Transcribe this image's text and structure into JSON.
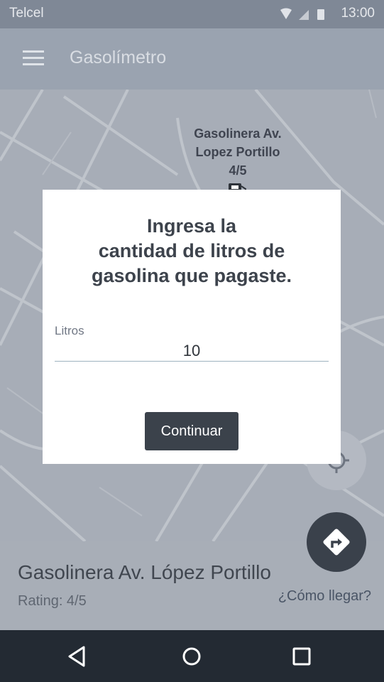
{
  "status_bar": {
    "carrier": "Telcel",
    "time": "13:00",
    "icons": [
      "wifi-icon",
      "signal-icon",
      "battery-icon"
    ]
  },
  "app_bar": {
    "title": "Gasolímetro",
    "menu_icon": "hamburger-menu-icon"
  },
  "map": {
    "marker": {
      "line1": "Gasolinera Av.",
      "line2": "Lopez Portillo",
      "rating": "4/5"
    }
  },
  "dialog": {
    "title_line1": "Ingresa la",
    "title_line2": "cantidad de litros de",
    "title_line3": "gasolina que pagaste.",
    "field_label": "Litros",
    "field_value": "10",
    "continue_label": "Continuar"
  },
  "bottom_panel": {
    "station_name": "Gasolinera Av. López Portillo",
    "rating": "Rating: 4/5",
    "directions_link": "¿Cómo llegar?"
  },
  "colors": {
    "status_bar": "#7f8896",
    "app_bar": "#9aa3b0",
    "dialog_button": "#3b424b",
    "fab": "#3a414b",
    "nav_bar": "#232a33"
  }
}
